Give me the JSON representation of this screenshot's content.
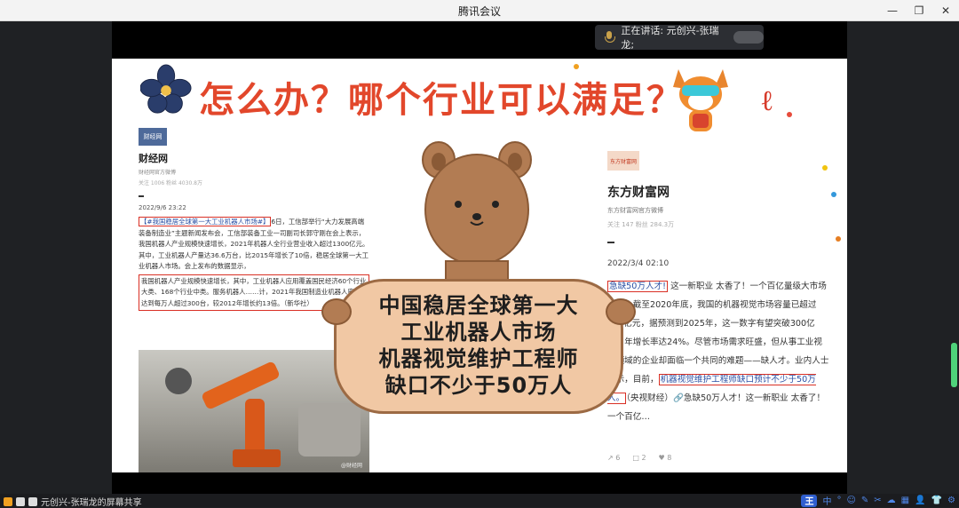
{
  "window": {
    "title": "腾讯会议",
    "controls": [
      "minimize-icon",
      "restore-icon",
      "close-icon"
    ]
  },
  "speaking": {
    "label": "正在讲话: 元创兴-张瑞龙;"
  },
  "slide": {
    "headline": "怎么办？哪个行业可以满足？",
    "left_post": {
      "logo": "财经网",
      "name": "财经网",
      "desc": "财经网官方微博",
      "stats": "关注 1006  粉丝 4030.8万",
      "date": "2022/9/6 23:22",
      "hashtag": "【#我国稳居全球第一大工业机器人市场#】",
      "body1": "6日，工信部举行“大力发展高端装备制造业”主题新闻发布会，工信部装备工业一司副司长郭守刚在会上表示，我国机器人产业规模快速增长，2021年机器人全行业营业收入超过1300亿元。其中，工业机器人产量达36.6万台，比2015年增长了10倍，稳居全球第一大工业机器人市场。会上发布的数据显示，",
      "body2": "我国机器人产业规模快速增长，其中，工业机器人应用覆盖国民经济60个行业大类、168个行业中类。服务机器人……计，2021年我国制造业机器人密度达到每万人超过300台，较2012年增长约13倍。（新华社）",
      "watermark": "@财经网"
    },
    "right_post": {
      "logo": "东方财富网",
      "name": "东方财富网",
      "desc": "东方财富网官方微博",
      "stats": "关注 147  粉丝 284.3万",
      "date": "2022/3/4 02:10",
      "hashtag": "急缺50万人才!",
      "body1": " 这一新职业 太香了！一个百亿量级大市场爆发】截至2020年底，我国的机器视觉市场容量已超过100亿元，据预测到2025年，这一数字有望突破300亿元，年增长率达24%。尽管市场需求旺盛，但从事工业视觉领域的企业却面临一个共同的难题——缺人才。业内人士表示，目前，",
      "highlight": "机器视觉维护工程师缺口预计不少于50万人。",
      "body2": "（央视财经）🔗急缺50万人才！这一新职业 太香了！一个百亿…",
      "foot": {
        "share": "6",
        "comment": "2",
        "like": "8"
      }
    },
    "board": {
      "line1": "中国稳居全球第一大",
      "line2": "工业机器人市场",
      "line3": "机器视觉维护工程师",
      "line4": "缺口不少于50万人"
    }
  },
  "bottom": {
    "share_label": "元创兴-张瑞龙的屏幕共享",
    "ime": "王",
    "ime_tools": [
      "中",
      "°",
      "☺",
      "✎",
      "✂",
      "☁",
      "▦",
      "👤",
      "👕",
      "⚙"
    ]
  },
  "colors": {
    "headline": "#e2472b",
    "highlight_border": "#d93025",
    "meeting_bg": "#1f2124",
    "board_bg": "#f1c8a4"
  }
}
